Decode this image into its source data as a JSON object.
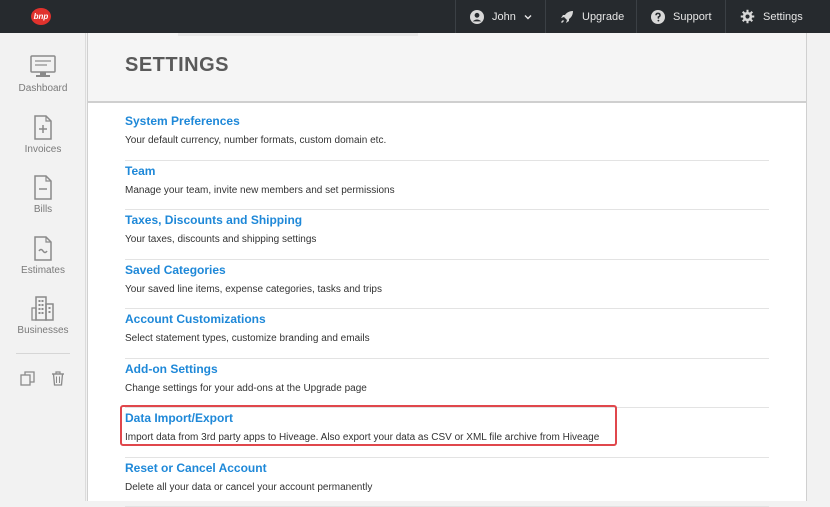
{
  "topbar": {
    "logo_text": "bnp",
    "user": "John",
    "upgrade": "Upgrade",
    "support": "Support",
    "settings": "Settings"
  },
  "sidebar": {
    "items": [
      {
        "label": "Dashboard",
        "icon": "monitor-icon"
      },
      {
        "label": "Invoices",
        "icon": "invoice-plus-icon"
      },
      {
        "label": "Bills",
        "icon": "bill-minus-icon"
      },
      {
        "label": "Estimates",
        "icon": "estimate-icon"
      },
      {
        "label": "Businesses",
        "icon": "buildings-icon"
      }
    ],
    "tools": [
      "copy-icon",
      "trash-icon"
    ]
  },
  "page": {
    "title": "SETTINGS"
  },
  "settings": [
    {
      "title": "System Preferences",
      "desc": "Your default currency, number formats, custom domain etc."
    },
    {
      "title": "Team",
      "desc": "Manage your team, invite new members and set permissions"
    },
    {
      "title": "Taxes, Discounts and Shipping",
      "desc": "Your taxes, discounts and shipping settings"
    },
    {
      "title": "Saved Categories",
      "desc": "Your saved line items, expense categories, tasks and trips"
    },
    {
      "title": "Account Customizations",
      "desc": "Select statement types, customize branding and emails"
    },
    {
      "title": "Add-on Settings",
      "desc": "Change settings for your add-ons at the Upgrade page"
    },
    {
      "title": "Data Import/Export",
      "desc": "Import data from 3rd party apps to Hiveage. Also export your data as CSV or XML file archive from Hiveage",
      "highlighted": true
    },
    {
      "title": "Reset or Cancel Account",
      "desc": "Delete all your data or cancel your account permanently"
    }
  ],
  "colors": {
    "accent": "#1e88d8",
    "highlight": "#e0474c",
    "topbar": "#262a2e"
  }
}
